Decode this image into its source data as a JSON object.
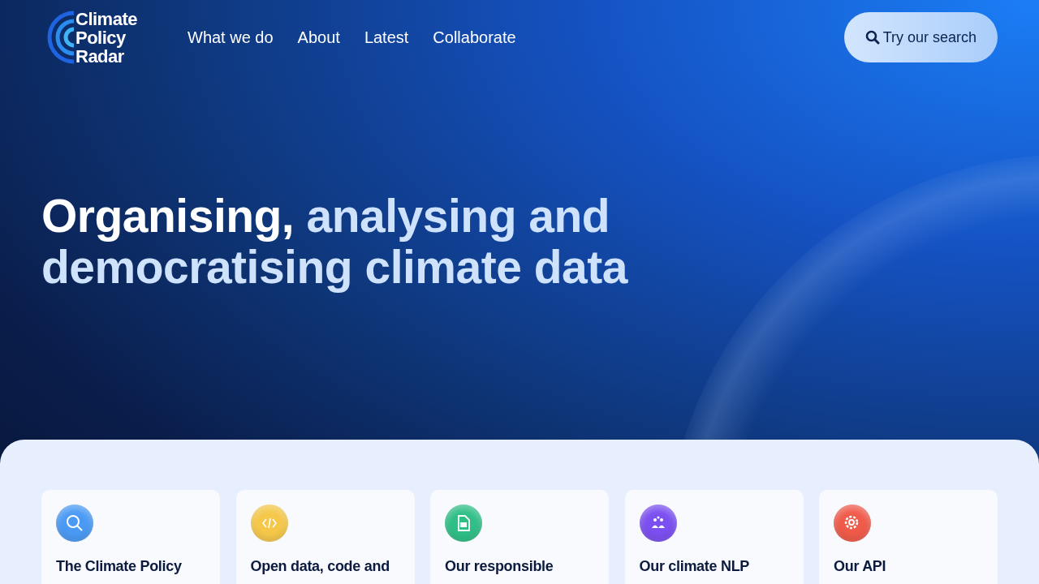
{
  "logo": {
    "text": "Climate Policy Radar"
  },
  "nav": [
    {
      "label": "What we do"
    },
    {
      "label": "About"
    },
    {
      "label": "Latest"
    },
    {
      "label": "Collaborate"
    }
  ],
  "search_button": {
    "label": "Try our search"
  },
  "hero": {
    "heading": [
      {
        "text": "Organising,",
        "highlight": true
      },
      {
        "text": "analysing and",
        "highlight": false
      },
      {
        "text": "democratising climate data",
        "highlight": false
      }
    ]
  },
  "cards": [
    {
      "kind": "search",
      "title": "The Climate Policy",
      "color": "#4a9af5"
    },
    {
      "kind": "code",
      "title": "Open data, code and",
      "color": "#f5c84a"
    },
    {
      "kind": "document",
      "title": "Our responsible",
      "color": "#2fbf86"
    },
    {
      "kind": "people",
      "title": "Our climate NLP",
      "color": "#7b4ff0"
    },
    {
      "kind": "gear",
      "title": "Our API",
      "color": "#f05a4a"
    }
  ]
}
